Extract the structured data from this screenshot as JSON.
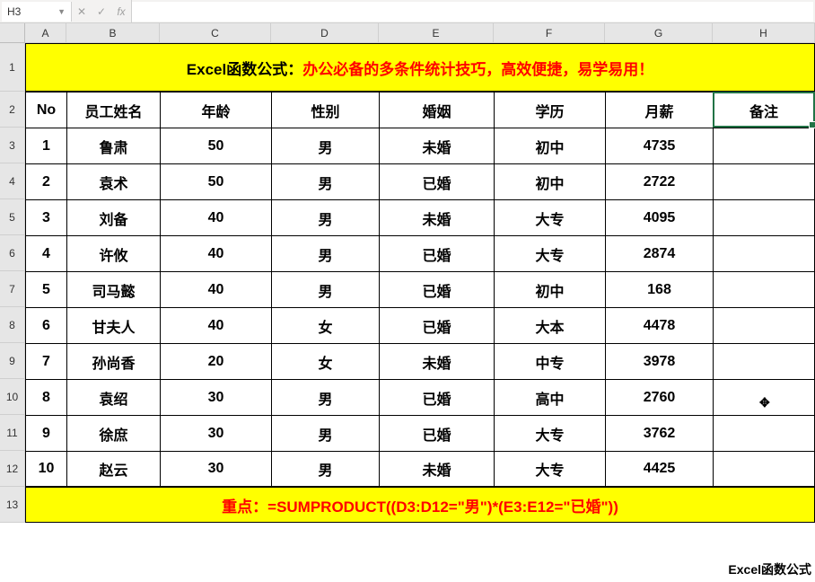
{
  "formula_bar": {
    "name_box": "H3",
    "formula": ""
  },
  "columns": [
    "A",
    "B",
    "C",
    "D",
    "E",
    "F",
    "G",
    "H"
  ],
  "row_numbers": [
    "1",
    "2",
    "3",
    "4",
    "5",
    "6",
    "7",
    "8",
    "9",
    "10",
    "11",
    "12",
    "13"
  ],
  "title": {
    "prefix": "Excel函数公式：",
    "body": "办公必备的多条件统计技巧，高效便捷，易学易用！"
  },
  "headers": [
    "No",
    "员工姓名",
    "年龄",
    "性别",
    "婚姻",
    "学历",
    "月薪",
    "备注"
  ],
  "rows": [
    {
      "no": "1",
      "name": "鲁肃",
      "age": "50",
      "sex": "男",
      "marital": "未婚",
      "edu": "初中",
      "salary": "4735",
      "note": ""
    },
    {
      "no": "2",
      "name": "袁术",
      "age": "50",
      "sex": "男",
      "marital": "已婚",
      "edu": "初中",
      "salary": "2722",
      "note": ""
    },
    {
      "no": "3",
      "name": "刘备",
      "age": "40",
      "sex": "男",
      "marital": "未婚",
      "edu": "大专",
      "salary": "4095",
      "note": ""
    },
    {
      "no": "4",
      "name": "许攸",
      "age": "40",
      "sex": "男",
      "marital": "已婚",
      "edu": "大专",
      "salary": "2874",
      "note": ""
    },
    {
      "no": "5",
      "name": "司马懿",
      "age": "40",
      "sex": "男",
      "marital": "已婚",
      "edu": "初中",
      "salary": "168",
      "note": ""
    },
    {
      "no": "6",
      "name": "甘夫人",
      "age": "40",
      "sex": "女",
      "marital": "已婚",
      "edu": "大本",
      "salary": "4478",
      "note": ""
    },
    {
      "no": "7",
      "name": "孙尚香",
      "age": "20",
      "sex": "女",
      "marital": "未婚",
      "edu": "中专",
      "salary": "3978",
      "note": ""
    },
    {
      "no": "8",
      "name": "袁绍",
      "age": "30",
      "sex": "男",
      "marital": "已婚",
      "edu": "高中",
      "salary": "2760",
      "note": ""
    },
    {
      "no": "9",
      "name": "徐庶",
      "age": "30",
      "sex": "男",
      "marital": "已婚",
      "edu": "大专",
      "salary": "3762",
      "note": ""
    },
    {
      "no": "10",
      "name": "赵云",
      "age": "30",
      "sex": "男",
      "marital": "未婚",
      "edu": "大专",
      "salary": "4425",
      "note": ""
    }
  ],
  "footer": {
    "label": "重点：",
    "formula": "=SUMPRODUCT((D3:D12=\"男\")*(E3:E12=\"已婚\"))"
  },
  "watermark": "Excel函数公式",
  "active_cell": "H3"
}
